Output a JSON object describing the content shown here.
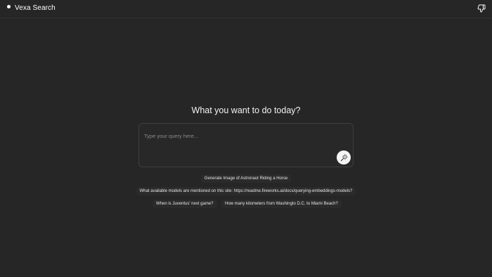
{
  "header": {
    "brand": "Vexa Search",
    "action_icon": "thumbs-down-icon"
  },
  "main": {
    "title": "What you want to do today?",
    "query": {
      "placeholder": "Type your query here...",
      "value": "",
      "submit_icon": "magic-wand-icon"
    },
    "suggestions": [
      "Generate Image of Astronaut Riding a Horse",
      "What available models are mentioned on this site: https://readme.fireworks.ai/docs/querying-embeddings-models?",
      "When is Juventus' next game?",
      "How many kilometers from Washingto D.C. to Miami Beach?"
    ]
  },
  "colors": {
    "background": "#262626",
    "border": "#3f3f3f",
    "text": "#ffffff",
    "placeholder": "#8a8a8a",
    "button": "#f4f4f4"
  }
}
